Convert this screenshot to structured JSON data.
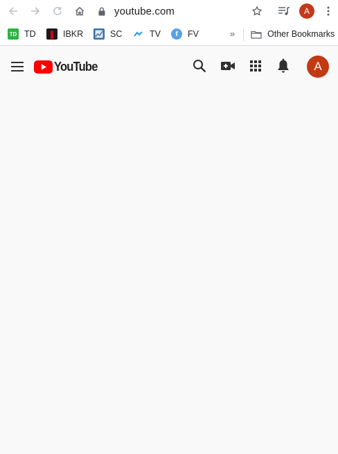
{
  "browser": {
    "url": "youtube.com",
    "profile_initial": "A"
  },
  "bookmarks": {
    "items": [
      {
        "label": "TD",
        "icon": "td-icon",
        "color": "#2ab441"
      },
      {
        "label": "IBKR",
        "icon": "ibkr-icon",
        "color": "#1a1a1a"
      },
      {
        "label": "SC",
        "icon": "sc-icon",
        "color": "#3a6ea5"
      },
      {
        "label": "TV",
        "icon": "tv-icon",
        "color": "#2196f3"
      },
      {
        "label": "FV",
        "icon": "fv-icon",
        "color": "#5aa0e6"
      }
    ],
    "overflow": "»",
    "other": "Other Bookmarks"
  },
  "youtube": {
    "logo_text": "YouTube",
    "avatar_initial": "A",
    "brand_color": "#ff0000",
    "avatar_color": "#c23a12"
  }
}
